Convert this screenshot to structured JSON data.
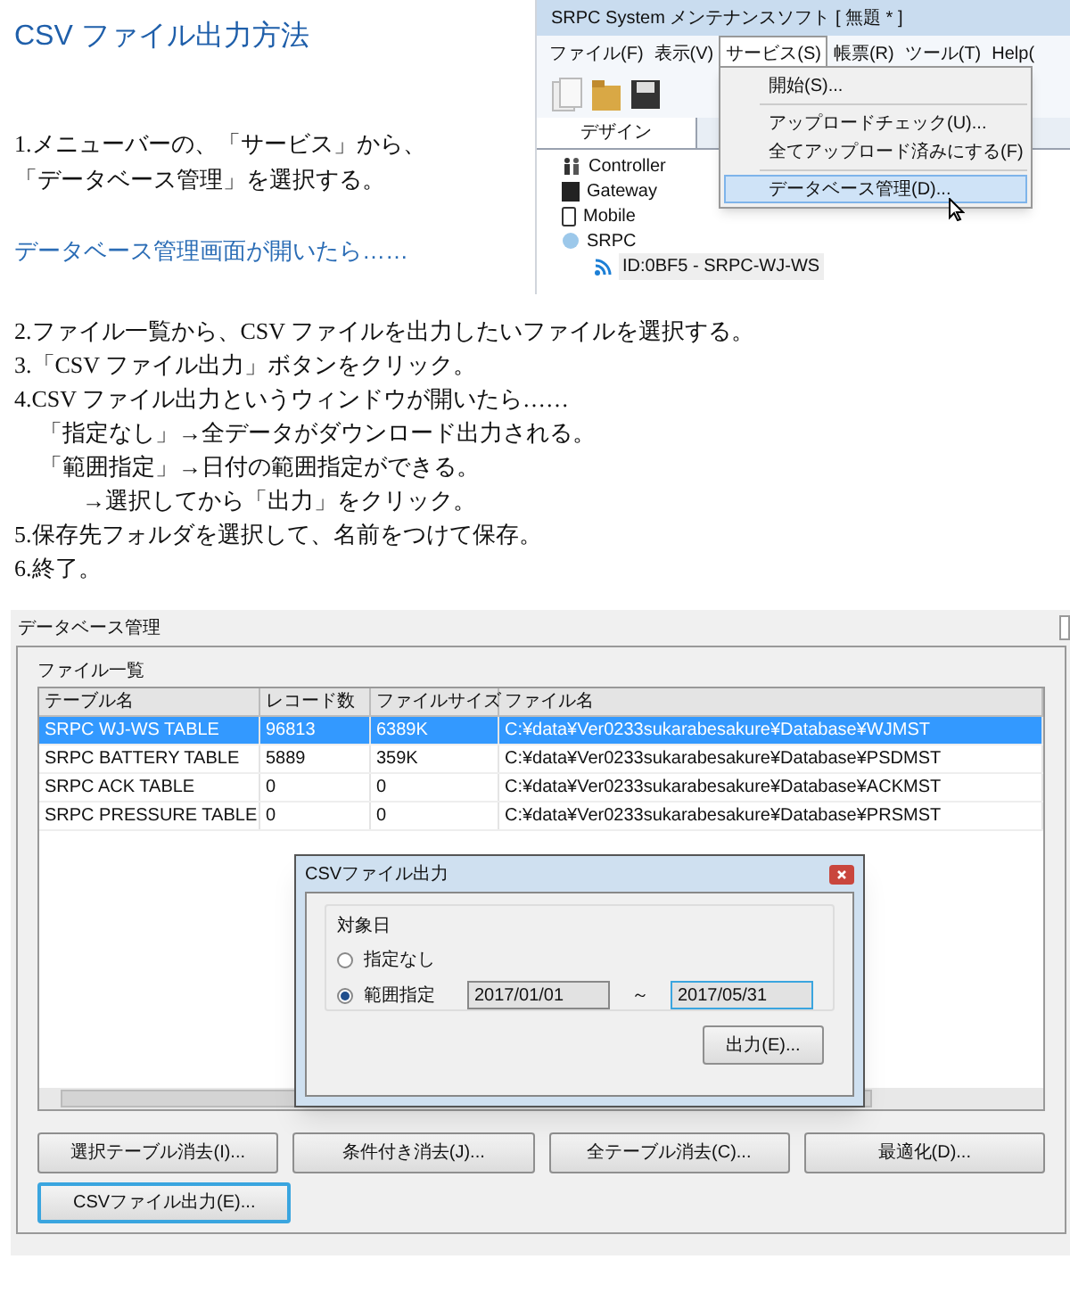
{
  "title": "CSV ファイル出力方法",
  "intro": [
    "1.メニューバーの、「サービス」から、",
    "「データベース管理」を選択する。"
  ],
  "subheading": "データベース管理画面が開いたら……",
  "app_screenshot": {
    "title": "SRPC System メンテナンスソフト [ 無題 * ]",
    "menu": [
      {
        "label": "ファイル(F)",
        "selected": false
      },
      {
        "label": "表示(V)",
        "selected": false
      },
      {
        "label": "サービス(S)",
        "selected": true
      },
      {
        "label": "帳票(R)",
        "selected": false
      },
      {
        "label": "ツール(T)",
        "selected": false
      },
      {
        "label": "Help(",
        "selected": false
      }
    ],
    "tab": "デザイン",
    "tree": [
      {
        "label": "Controller",
        "kind": "controller",
        "selected": false
      },
      {
        "label": "Gateway",
        "kind": "gateway",
        "selected": false
      },
      {
        "label": "Mobile",
        "kind": "mobile",
        "selected": false
      },
      {
        "label": "SRPC",
        "kind": "srpc",
        "selected": false,
        "children": [
          {
            "label": "ID:0BF5 - SRPC-WJ-WS",
            "kind": "signal",
            "selected": true
          }
        ]
      }
    ],
    "dropdown_groups": [
      [
        {
          "label": "開始(S)...",
          "selected": false
        }
      ],
      [
        {
          "label": "アップロードチェック(U)...",
          "selected": false
        },
        {
          "label": "全てアップロード済みにする(F)",
          "selected": false
        }
      ],
      [
        {
          "label": "データベース管理(D)...",
          "selected": true
        }
      ]
    ]
  },
  "steps": [
    {
      "kind": "step",
      "text": "2.ファイル一覧から、CSV ファイルを出力したいファイルを選択する。"
    },
    {
      "kind": "step",
      "text": "3.「CSV ファイル出力」ボタンをクリック。"
    },
    {
      "kind": "step",
      "text": "4.CSV ファイル出力というウィンドウが開いたら……"
    },
    {
      "kind": "sub",
      "text": "「指定なし」→全データがダウンロード出力される。"
    },
    {
      "kind": "sub",
      "text": "「範囲指定」→日付の範囲指定ができる。"
    },
    {
      "kind": "subsub",
      "text": "→選択してから「出力」をクリック。"
    },
    {
      "kind": "step",
      "text": "5.保存先フォルダを選択して、名前をつけて保存。"
    },
    {
      "kind": "step",
      "text": "6.終了。"
    }
  ],
  "db_window": {
    "title": "データベース管理",
    "group_label": "ファイル一覧",
    "columns": [
      "テーブル名",
      "レコード数",
      "ファイルサイズ",
      "ファイル名"
    ],
    "rows": [
      {
        "cells": [
          "SRPC WJ-WS TABLE",
          "96813",
          "6389K",
          "C:¥data¥Ver0233sukarabesakure¥Database¥WJMST"
        ],
        "selected": true
      },
      {
        "cells": [
          "SRPC BATTERY TABLE",
          "5889",
          "359K",
          "C:¥data¥Ver0233sukarabesakure¥Database¥PSDMST"
        ],
        "selected": false
      },
      {
        "cells": [
          "SRPC ACK TABLE",
          "0",
          "0",
          "C:¥data¥Ver0233sukarabesakure¥Database¥ACKMST"
        ],
        "selected": false
      },
      {
        "cells": [
          "SRPC PRESSURE TABLE",
          "0",
          "0",
          "C:¥data¥Ver0233sukarabesakure¥Database¥PRSMST"
        ],
        "selected": false
      }
    ],
    "buttons": [
      {
        "label": "選択テーブル消去(I)...",
        "focused": false
      },
      {
        "label": "条件付き消去(J)...",
        "focused": false
      },
      {
        "label": "全テーブル消去(C)...",
        "focused": false
      },
      {
        "label": "最適化(D)...",
        "focused": false
      },
      {
        "label": "CSVファイル出力(E)...",
        "focused": true
      }
    ]
  },
  "dialog": {
    "title": "CSVファイル出力",
    "group_label": "対象日",
    "options": [
      {
        "label": "指定なし",
        "selected": false
      },
      {
        "label": "範囲指定",
        "selected": true
      }
    ],
    "date_from": "2017/01/01",
    "range_sign": "～",
    "date_to": "2017/05/31",
    "button": "出力(E)..."
  }
}
